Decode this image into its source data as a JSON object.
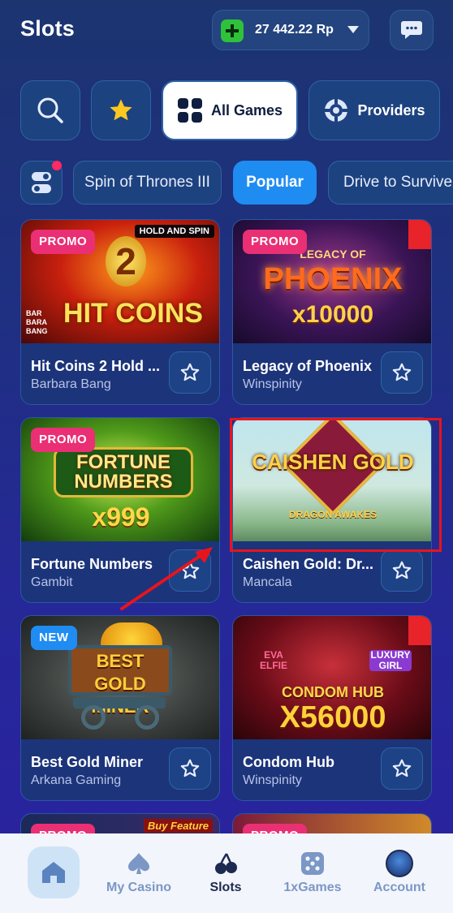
{
  "header": {
    "title": "Slots",
    "balance": "27 442.22 Rp"
  },
  "tabs": [
    {
      "icon": "search-icon"
    },
    {
      "icon": "star-icon"
    },
    {
      "label": "All Games",
      "icon": "grid-icon",
      "active": true
    },
    {
      "label": "Providers",
      "icon": "chip-icon"
    }
  ],
  "chips": [
    {
      "label": "Spin of Thrones III"
    },
    {
      "label": "Popular",
      "active": true
    },
    {
      "label": "Drive to Survive"
    }
  ],
  "games": [
    {
      "name": "Hit Coins 2 Hold ...",
      "provider": "Barbara Bang",
      "badge": "PROMO",
      "thumb_title": "HIT COINS",
      "thumb_sub": "HOLD AND SPIN",
      "thumb_corner": "BAR BARA BANG",
      "thumb_num": "2"
    },
    {
      "name": "Legacy of Phoenix",
      "provider": "Winspinity",
      "badge": "PROMO",
      "thumb_title": "PHOENIX",
      "thumb_sub": "LEGACY OF",
      "thumb_num": "x10000"
    },
    {
      "name": "Fortune Numbers",
      "provider": "Gambit",
      "badge": "PROMO",
      "thumb_title": "FORTUNE NUMBERS",
      "thumb_num": "x999"
    },
    {
      "name": "Caishen Gold: Dr...",
      "provider": "Mancala",
      "badge": "",
      "thumb_title": "CAISHEN GOLD",
      "thumb_sub": "DRAGON AWAKES"
    },
    {
      "name": "Best Gold Miner",
      "provider": "Arkana Gaming",
      "badge": "NEW",
      "thumb_title": "BEST GOLD MINER"
    },
    {
      "name": "Condom Hub",
      "provider": "Winspinity",
      "badge": "",
      "thumb_title": "CONDOM HUB",
      "thumb_num": "X56000",
      "thumb_tag1": "EVA ELFIE",
      "thumb_tag2": "LUXURY GIRL"
    }
  ],
  "partial_row": {
    "badge_left": "PROMO",
    "badge_right": "PROMO",
    "tag": "Buy Feature"
  },
  "nav": [
    {
      "label": "",
      "icon": "home-icon"
    },
    {
      "label": "My Casino",
      "icon": "spade-icon"
    },
    {
      "label": "Slots",
      "icon": "cherry-icon",
      "current": true
    },
    {
      "label": "1xGames",
      "icon": "dice-icon"
    },
    {
      "label": "Account",
      "icon": "avatar-icon"
    }
  ],
  "colors": {
    "accent": "#1f8cf2",
    "promo": "#ea2f74",
    "highlight": "#e8141c"
  }
}
